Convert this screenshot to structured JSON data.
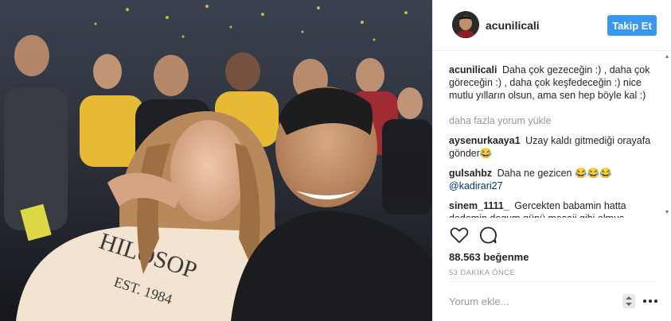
{
  "post": {
    "username": "acunilicali",
    "follow_label": "Takip Et"
  },
  "caption": {
    "username": "acunilicali",
    "text": "Daha çok gezeceğin :) , daha çok göreceğin :) , daha çok keşfedeceğin :) nice mutlu yılların olsun, ama sen hep böyle kal :)"
  },
  "load_more_label": "daha fazla yorum yükle",
  "comments": [
    {
      "username": "aysenurkaaya1",
      "text": "Uzay kaldı gitmediği orayafa gönder😂",
      "mention": ""
    },
    {
      "username": "gulsahbz",
      "text": "Daha ne gezicen 😂😂😂",
      "mention": "@kadirari27"
    },
    {
      "username": "sinem_1111_",
      "text": "Gercekten babamin hatta dedemin dogum günü mesaji gibi olmus",
      "mention": ""
    }
  ],
  "actions": {
    "like_icon": "heart-icon",
    "comment_icon": "comment-icon"
  },
  "likes_text": "88.563 beğenme",
  "timestamp": "53 DAKİKA ÖNCE",
  "comment_input": {
    "placeholder": "Yorum ekle..."
  },
  "colors": {
    "follow_bg": "#3897f0",
    "text": "#262626",
    "muted": "#999999",
    "mention": "#003569",
    "border": "#efefef"
  }
}
